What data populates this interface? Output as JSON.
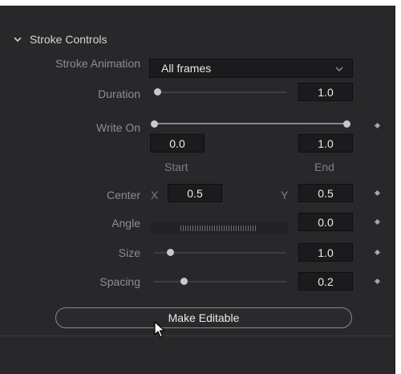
{
  "section": {
    "title": "Stroke Controls"
  },
  "stroke_animation": {
    "label": "Stroke Animation",
    "value": "All frames"
  },
  "duration": {
    "label": "Duration",
    "value": "1.0",
    "slider": 0.0
  },
  "write_on": {
    "label": "Write On",
    "start": "0.0",
    "end": "1.0",
    "start_caption": "Start",
    "end_caption": "End"
  },
  "center": {
    "label": "Center",
    "x_label": "X",
    "x_value": "0.5",
    "y_label": "Y",
    "y_value": "0.5"
  },
  "angle": {
    "label": "Angle",
    "value": "0.0"
  },
  "size": {
    "label": "Size",
    "value": "1.0",
    "slider": 0.1
  },
  "spacing": {
    "label": "Spacing",
    "value": "0.2",
    "slider": 0.2
  },
  "make_editable": {
    "label": "Make Editable"
  },
  "icons": [
    "chevron-down-icon",
    "dropdown-chevron-icon",
    "keyframe-diamond-icon",
    "mouse-pointer-icon"
  ]
}
